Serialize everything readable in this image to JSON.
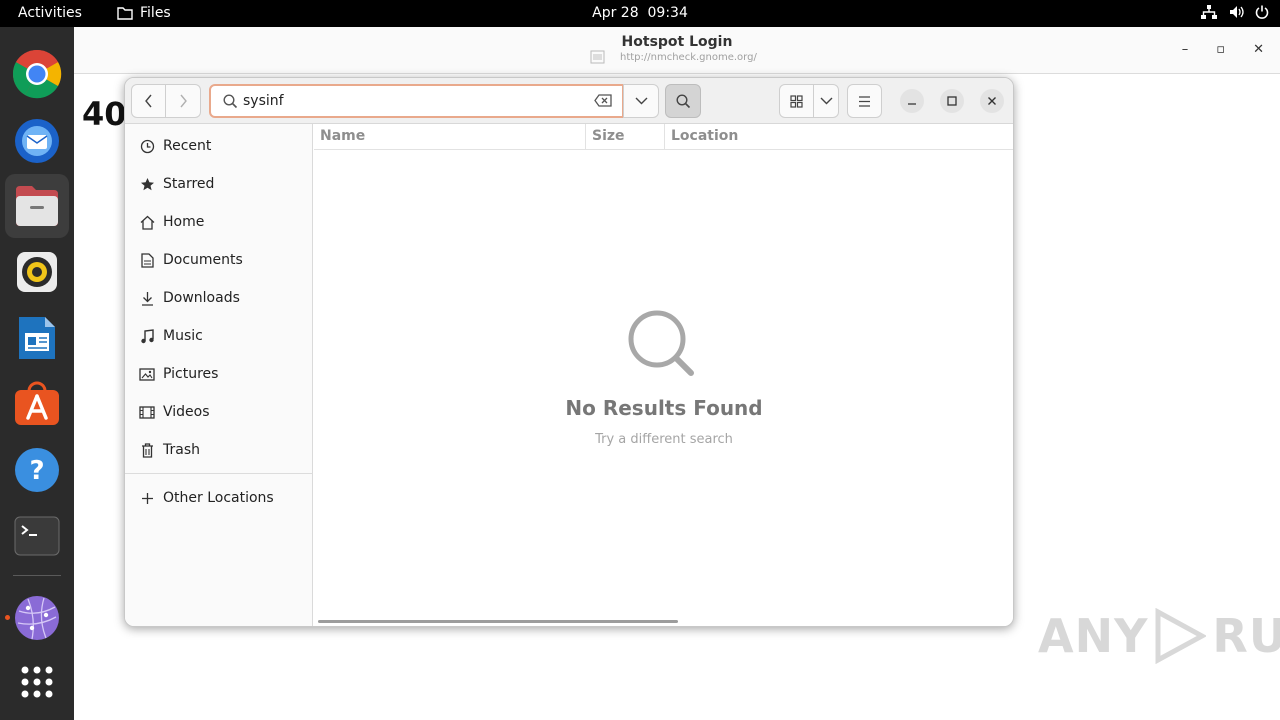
{
  "topbar": {
    "activities": "Activities",
    "app_name": "Files",
    "date": "Apr 28",
    "time": "09:34"
  },
  "dock": {
    "apps": [
      "Google Chrome",
      "Thunderbird Mail",
      "Files",
      "Rhythmbox",
      "LibreOffice Writer",
      "Ubuntu Software",
      "Help",
      "Terminal",
      "Web Browser",
      "Show Applications"
    ]
  },
  "background_window": {
    "title": "Hotspot Login",
    "url": "http://nmcheck.gnome.org/",
    "page_heading": "40"
  },
  "files_window": {
    "search": {
      "value": "sysinf"
    },
    "sidebar": {
      "items": [
        {
          "label": "Recent",
          "icon": "recent-icon"
        },
        {
          "label": "Starred",
          "icon": "star-icon"
        },
        {
          "label": "Home",
          "icon": "home-icon"
        },
        {
          "label": "Documents",
          "icon": "documents-icon"
        },
        {
          "label": "Downloads",
          "icon": "downloads-icon"
        },
        {
          "label": "Music",
          "icon": "music-icon"
        },
        {
          "label": "Pictures",
          "icon": "pictures-icon"
        },
        {
          "label": "Videos",
          "icon": "videos-icon"
        },
        {
          "label": "Trash",
          "icon": "trash-icon"
        }
      ],
      "other_locations": "Other Locations"
    },
    "columns": {
      "name": "Name",
      "size": "Size",
      "location": "Location"
    },
    "empty_state": {
      "title": "No Results Found",
      "subtitle": "Try a different search"
    }
  },
  "watermark": {
    "left": "ANY",
    "right": "RUN"
  },
  "colors": {
    "accent": "#e95420",
    "search_border": "#e9a98c",
    "dock_bg": "#2b2b2b"
  }
}
